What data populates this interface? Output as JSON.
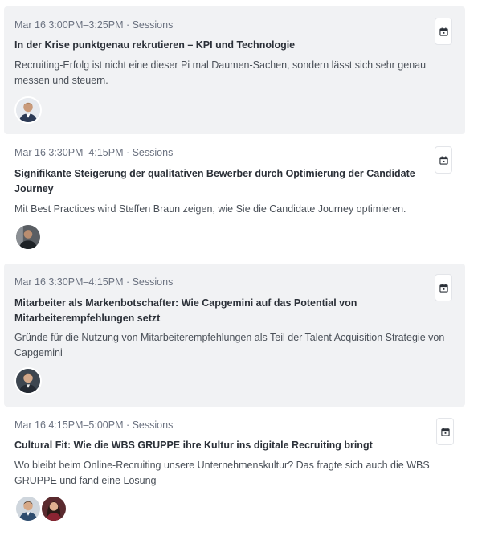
{
  "sessions": [
    {
      "meta": "Mar 16 3:00PM–3:25PM · Sessions",
      "title": "In der Krise punktgenau rekrutieren – KPI und Technologie",
      "description": "Recruiting-Erfolg ist nicht eine dieser Pi mal Daumen-Sachen, sondern lässt sich sehr genau messen und steuern.",
      "speakers": [
        "speaker-1"
      ]
    },
    {
      "meta": "Mar 16 3:30PM–4:15PM · Sessions",
      "title": "Signifikante Steigerung der qualitativen Bewerber durch Optimierung der Candidate Journey",
      "description": "Mit Best Practices wird Steffen Braun zeigen, wie Sie die Candidate Journey optimieren.",
      "speakers": [
        "speaker-2"
      ]
    },
    {
      "meta": "Mar 16 3:30PM–4:15PM · Sessions",
      "title": "Mitarbeiter als Markenbotschafter: Wie Capgemini auf das Potential von Mitarbeiterempfehlungen setzt",
      "description": "Gründe für die Nutzung von Mitarbeiterempfehlungen als Teil der Talent Acquisition Strategie von Capgemini",
      "speakers": [
        "speaker-3"
      ]
    },
    {
      "meta": "Mar 16 4:15PM–5:00PM · Sessions",
      "title": "Cultural Fit: Wie die WBS GRUPPE ihre Kultur ins digitale Recruiting bringt",
      "description": "Wo bleibt beim Online-Recruiting unsere Unternehmenskultur? Das fragte sich auch die WBS GRUPPE und fand eine Lösung",
      "speakers": [
        "speaker-4",
        "speaker-5"
      ]
    }
  ],
  "icons": {
    "add_to_calendar": "calendar-add-icon"
  },
  "colors": {
    "shaded_card": "#f1f2f4",
    "meta_text": "#6b7280",
    "title_text": "#2b3038"
  }
}
